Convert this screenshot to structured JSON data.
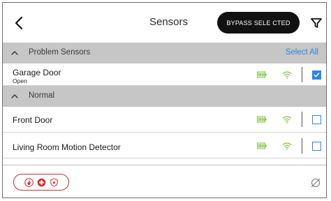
{
  "header": {
    "title": "Sensors",
    "bypass_label": "BYPASS SELE CTED"
  },
  "sections": {
    "problem": {
      "label": "Problem Sensors",
      "select_all": "Select All"
    },
    "normal": {
      "label": "Normal"
    }
  },
  "sensors": {
    "problem": [
      {
        "name": "Garage Door",
        "status": "Open",
        "checked": true
      }
    ],
    "normal": [
      {
        "name": "Front Door",
        "checked": false
      },
      {
        "name": "Living Room Motion Detector",
        "checked": false
      }
    ]
  },
  "colors": {
    "accent": "#2f86e0",
    "section_bar": "#c6c6c6",
    "battery_wifi": "#7fc241",
    "emergency": "#d12b2b",
    "bypass_bg": "#111111"
  },
  "icons": {
    "back": "chevron-left-icon",
    "filter": "filter-icon",
    "collapse": "chevron-up-icon",
    "battery": "battery-icon",
    "signal": "wifi-icon",
    "emergency": [
      "fire-icon",
      "medical-icon",
      "police-icon"
    ],
    "no_items": "circle-slash-icon"
  }
}
